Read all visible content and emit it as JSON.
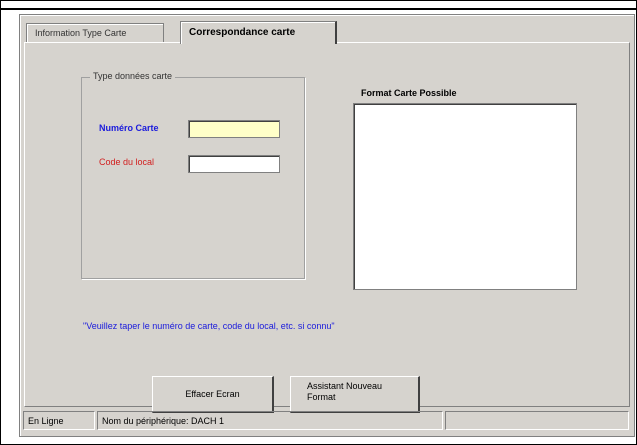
{
  "tabs": [
    {
      "label": "Information Type Carte",
      "active": false
    },
    {
      "label": "Correspondance carte",
      "active": true
    }
  ],
  "groupbox": {
    "title": "Type données carte",
    "fields": [
      {
        "label": "Numéro Carte",
        "value": "",
        "color": "#1a1adc"
      },
      {
        "label": "Code du local",
        "value": "",
        "color": "#d21e1e"
      }
    ]
  },
  "list": {
    "title": "Format Carte Possible",
    "items": []
  },
  "hint": "\"Veuillez taper le numéro de carte, code du local, etc. si connu\"",
  "buttons": {
    "clear": "Effacer Ecran",
    "new_format_line1": "Assistant Nouveau",
    "new_format_line2": "Format"
  },
  "statusbar": {
    "state": "En Ligne",
    "device": "Nom du périphérique: DACH 1",
    "extra": ""
  },
  "colors": {
    "window_bg": "#d6d3ce",
    "accent_blue": "#1a1adc",
    "accent_red": "#d21e1e",
    "highlight_input": "#ffffc8"
  }
}
